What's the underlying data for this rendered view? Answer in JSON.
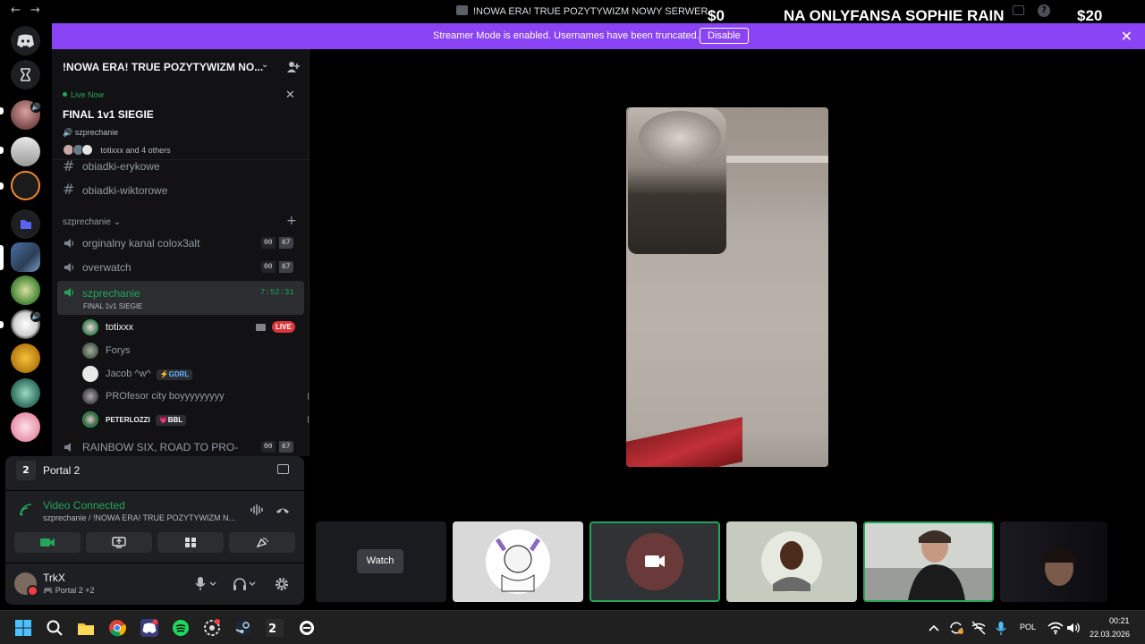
{
  "titlebar": {
    "back": "←",
    "forward": "→",
    "title": "!NOWA ERA! TRUE POZYTYWIZM NOWY SERWER",
    "help": "?"
  },
  "stream_overlay": {
    "left": "$0",
    "middle": "NA ONLYFANSA SOPHIE RAIN",
    "right": "$20"
  },
  "banner": {
    "text": "Streamer Mode is enabled. Usernames have been truncated.",
    "button": "Disable",
    "close": "✕"
  },
  "server": {
    "name": "!NOWA ERA! TRUE POZYTYWIZM NO...",
    "chevron": "⌄"
  },
  "live_card": {
    "status": "Live Now",
    "title": "FINAL 1v1 SIEGIE",
    "channel": "szprechanie",
    "viewers": "totixxx and 4 others",
    "close": "✕"
  },
  "text_channels": [
    {
      "name": "obiadki-erykowe"
    },
    {
      "name": "obiadki-wiktorowe"
    }
  ],
  "category": {
    "name": "szprechanie ⌄",
    "add": "+"
  },
  "voice_channels": [
    {
      "name": "orginalny kanal colox3alt",
      "count_a": "00",
      "count_b": "67"
    },
    {
      "name": "overwatch",
      "count_a": "00",
      "count_b": "67"
    }
  ],
  "active_channel": {
    "name": "szprechanie",
    "subtitle": "FINAL 1v1 SIEGIE",
    "timer": "7:52:31"
  },
  "members": [
    {
      "name": "totixxx",
      "badge": "LIVE"
    },
    {
      "name": "Forys"
    },
    {
      "name": "Jacob ^w^",
      "tag": "⚡GDRL"
    },
    {
      "name": "PROfesor city boyyyyyyyyy"
    },
    {
      "name": "PETERLOZZI",
      "tag": "💗BBL"
    }
  ],
  "cut_channel": {
    "name": "RAINBOW SIX, ROAD TO PRO-",
    "count_a": "00",
    "count_b": "67"
  },
  "game_panel": {
    "icon": "2",
    "name": "Portal 2"
  },
  "voice_panel": {
    "status": "Video Connected",
    "location": "szprechanie / !NOWA ERA! TRUE POZYTYWIZM N..."
  },
  "user_panel": {
    "name": "TrkX",
    "activity": "🎮 Portal 2 +2",
    "chevron": "⌄"
  },
  "stage": {
    "watch_label": "Watch"
  },
  "taskbar": {
    "language": "POL",
    "time": "00:21",
    "date": "22.03.2026"
  },
  "colors": {
    "streamer_banner": "#8a43f5",
    "online_green": "#23a55a",
    "live_red": "#da373c"
  }
}
